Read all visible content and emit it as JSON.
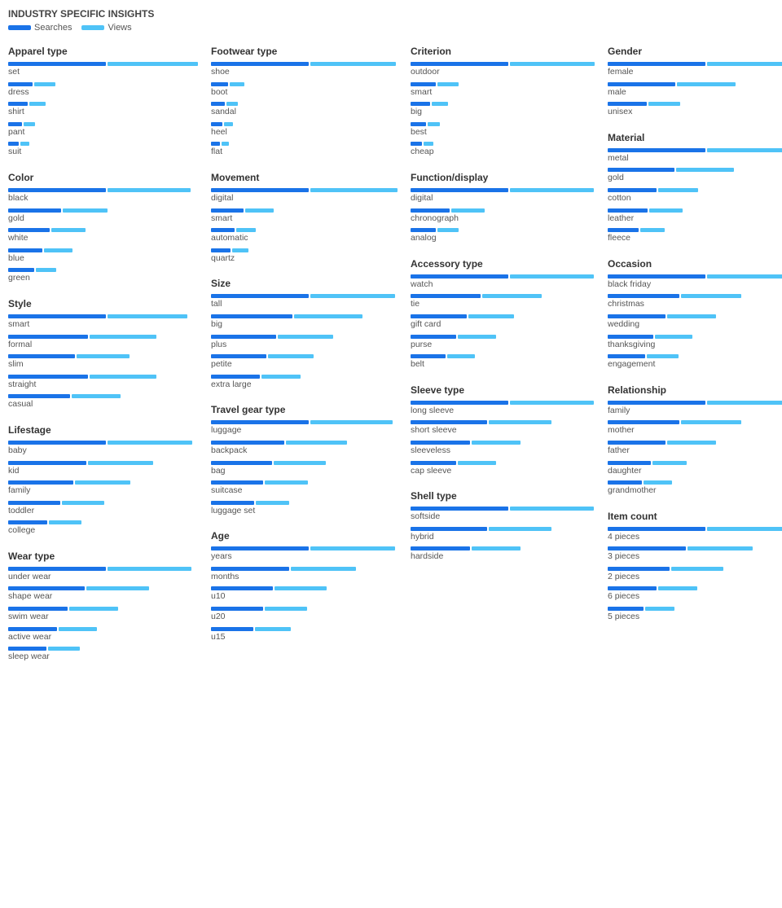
{
  "header": {
    "title": "INDUSTRY SPECIFIC INSIGHTS",
    "legend": {
      "searches_label": "Searches",
      "views_label": "Views"
    }
  },
  "sections": [
    {
      "id": "apparel-type",
      "title": "Apparel type",
      "col": 0,
      "items": [
        {
          "label": "set",
          "searches": 130,
          "views": 120
        },
        {
          "label": "dress",
          "searches": 32,
          "views": 28
        },
        {
          "label": "shirt",
          "searches": 26,
          "views": 22
        },
        {
          "label": "pant",
          "searches": 18,
          "views": 15
        },
        {
          "label": "suit",
          "searches": 14,
          "views": 12
        }
      ]
    },
    {
      "id": "footwear-type",
      "title": "Footwear type",
      "col": 1,
      "items": [
        {
          "label": "shoe",
          "searches": 160,
          "views": 140
        },
        {
          "label": "boot",
          "searches": 28,
          "views": 24
        },
        {
          "label": "sandal",
          "searches": 22,
          "views": 18
        },
        {
          "label": "heel",
          "searches": 18,
          "views": 15
        },
        {
          "label": "flat",
          "searches": 15,
          "views": 12
        }
      ]
    },
    {
      "id": "criterion",
      "title": "Criterion",
      "col": 2,
      "items": [
        {
          "label": "outdoor",
          "searches": 110,
          "views": 95
        },
        {
          "label": "smart",
          "searches": 28,
          "views": 24
        },
        {
          "label": "big",
          "searches": 22,
          "views": 18
        },
        {
          "label": "best",
          "searches": 17,
          "views": 14
        },
        {
          "label": "cheap",
          "searches": 13,
          "views": 11
        }
      ]
    },
    {
      "id": "gender",
      "title": "Gender",
      "col": 3,
      "items": [
        {
          "label": "female",
          "searches": 55,
          "views": 48
        },
        {
          "label": "male",
          "searches": 38,
          "views": 33
        },
        {
          "label": "unisex",
          "searches": 22,
          "views": 18
        }
      ]
    },
    {
      "id": "color",
      "title": "Color",
      "col": 0,
      "items": [
        {
          "label": "black",
          "searches": 52,
          "views": 44
        },
        {
          "label": "gold",
          "searches": 28,
          "views": 24
        },
        {
          "label": "white",
          "searches": 22,
          "views": 18
        },
        {
          "label": "blue",
          "searches": 18,
          "views": 15
        },
        {
          "label": "green",
          "searches": 14,
          "views": 11
        }
      ]
    },
    {
      "id": "movement",
      "title": "Movement",
      "col": 1,
      "items": [
        {
          "label": "digital",
          "searches": 90,
          "views": 80
        },
        {
          "label": "smart",
          "searches": 30,
          "views": 26
        },
        {
          "label": "automatic",
          "searches": 22,
          "views": 18
        },
        {
          "label": "quartz",
          "searches": 18,
          "views": 15
        }
      ]
    },
    {
      "id": "function-display",
      "title": "Function/display",
      "col": 2,
      "items": [
        {
          "label": "digital",
          "searches": 70,
          "views": 60
        },
        {
          "label": "chronograph",
          "searches": 28,
          "views": 24
        },
        {
          "label": "analog",
          "searches": 18,
          "views": 15
        }
      ]
    },
    {
      "id": "material",
      "title": "Material",
      "col": 3,
      "items": [
        {
          "label": "metal",
          "searches": 44,
          "views": 38
        },
        {
          "label": "gold",
          "searches": 30,
          "views": 26
        },
        {
          "label": "cotton",
          "searches": 22,
          "views": 18
        },
        {
          "label": "leather",
          "searches": 18,
          "views": 15
        },
        {
          "label": "fleece",
          "searches": 14,
          "views": 11
        }
      ]
    },
    {
      "id": "style",
      "title": "Style",
      "col": 0,
      "items": [
        {
          "label": "smart",
          "searches": 22,
          "views": 18
        },
        {
          "label": "formal",
          "searches": 18,
          "views": 15
        },
        {
          "label": "slim",
          "searches": 15,
          "views": 12
        },
        {
          "label": "straight",
          "searches": 18,
          "views": 15
        },
        {
          "label": "casual",
          "searches": 14,
          "views": 11
        }
      ]
    },
    {
      "id": "size",
      "title": "Size",
      "col": 1,
      "items": [
        {
          "label": "tall",
          "searches": 30,
          "views": 26
        },
        {
          "label": "big",
          "searches": 25,
          "views": 21
        },
        {
          "label": "plus",
          "searches": 20,
          "views": 17
        },
        {
          "label": "petite",
          "searches": 17,
          "views": 14
        },
        {
          "label": "extra large",
          "searches": 15,
          "views": 12
        }
      ]
    },
    {
      "id": "accessory-type",
      "title": "Accessory type",
      "col": 2,
      "items": [
        {
          "label": "watch",
          "searches": 28,
          "views": 24
        },
        {
          "label": "tie",
          "searches": 20,
          "views": 17
        },
        {
          "label": "gift card",
          "searches": 16,
          "views": 13
        },
        {
          "label": "purse",
          "searches": 13,
          "views": 11
        },
        {
          "label": "belt",
          "searches": 10,
          "views": 8
        }
      ]
    },
    {
      "id": "occasion",
      "title": "Occasion",
      "col": 3,
      "items": [
        {
          "label": "black friday",
          "searches": 34,
          "views": 29
        },
        {
          "label": "christmas",
          "searches": 25,
          "views": 21
        },
        {
          "label": "wedding",
          "searches": 20,
          "views": 17
        },
        {
          "label": "thanksgiving",
          "searches": 16,
          "views": 13
        },
        {
          "label": "engagement",
          "searches": 13,
          "views": 11
        }
      ]
    },
    {
      "id": "lifestage",
      "title": "Lifestage",
      "col": 0,
      "items": [
        {
          "label": "baby",
          "searches": 30,
          "views": 26
        },
        {
          "label": "kid",
          "searches": 24,
          "views": 20
        },
        {
          "label": "family",
          "searches": 20,
          "views": 17
        },
        {
          "label": "toddler",
          "searches": 16,
          "views": 13
        },
        {
          "label": "college",
          "searches": 12,
          "views": 10
        }
      ]
    },
    {
      "id": "travel-gear-type",
      "title": "Travel gear type",
      "col": 1,
      "items": [
        {
          "label": "luggage",
          "searches": 32,
          "views": 27
        },
        {
          "label": "backpack",
          "searches": 24,
          "views": 20
        },
        {
          "label": "bag",
          "searches": 20,
          "views": 17
        },
        {
          "label": "suitcase",
          "searches": 17,
          "views": 14
        },
        {
          "label": "luggage set",
          "searches": 14,
          "views": 11
        }
      ]
    },
    {
      "id": "sleeve-type",
      "title": "Sleeve type",
      "col": 2,
      "items": [
        {
          "label": "long sleeve",
          "searches": 28,
          "views": 24
        },
        {
          "label": "short sleeve",
          "searches": 22,
          "views": 18
        },
        {
          "label": "sleeveless",
          "searches": 17,
          "views": 14
        },
        {
          "label": "cap sleeve",
          "searches": 13,
          "views": 11
        }
      ]
    },
    {
      "id": "relationship",
      "title": "Relationship",
      "col": 3,
      "items": [
        {
          "label": "family",
          "searches": 34,
          "views": 29
        },
        {
          "label": "mother",
          "searches": 25,
          "views": 21
        },
        {
          "label": "father",
          "searches": 20,
          "views": 17
        },
        {
          "label": "daughter",
          "searches": 15,
          "views": 12
        },
        {
          "label": "grandmother",
          "searches": 12,
          "views": 10
        }
      ]
    },
    {
      "id": "wear-type",
      "title": "Wear type",
      "col": 0,
      "items": [
        {
          "label": "under wear",
          "searches": 28,
          "views": 24
        },
        {
          "label": "shape wear",
          "searches": 22,
          "views": 18
        },
        {
          "label": "swim wear",
          "searches": 17,
          "views": 14
        },
        {
          "label": "active wear",
          "searches": 14,
          "views": 11
        },
        {
          "label": "sleep wear",
          "searches": 11,
          "views": 9
        }
      ]
    },
    {
      "id": "age",
      "title": "Age",
      "col": 1,
      "items": [
        {
          "label": "years",
          "searches": 30,
          "views": 26
        },
        {
          "label": "months",
          "searches": 24,
          "views": 20
        },
        {
          "label": "u10",
          "searches": 19,
          "views": 16
        },
        {
          "label": "u20",
          "searches": 16,
          "views": 13
        },
        {
          "label": "u15",
          "searches": 13,
          "views": 11
        }
      ]
    },
    {
      "id": "shell-type",
      "title": "Shell type",
      "col": 2,
      "items": [
        {
          "label": "softside",
          "searches": 28,
          "views": 24
        },
        {
          "label": "hybrid",
          "searches": 22,
          "views": 18
        },
        {
          "label": "hardside",
          "searches": 17,
          "views": 14
        }
      ]
    },
    {
      "id": "item-count",
      "title": "Item count",
      "col": 3,
      "items": [
        {
          "label": "4 pieces",
          "searches": 30,
          "views": 26
        },
        {
          "label": "3 pieces",
          "searches": 24,
          "views": 20
        },
        {
          "label": "2 pieces",
          "searches": 19,
          "views": 16
        },
        {
          "label": "6 pieces",
          "searches": 15,
          "views": 12
        },
        {
          "label": "5 pieces",
          "searches": 11,
          "views": 9
        }
      ]
    }
  ]
}
